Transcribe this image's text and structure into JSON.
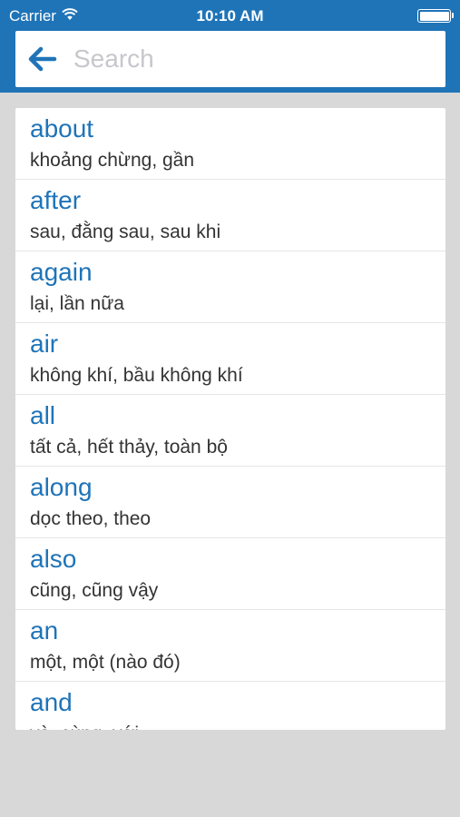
{
  "status": {
    "carrier": "Carrier",
    "time": "10:10 AM",
    "wifi_icon": "wifi-icon",
    "battery_icon": "battery-icon"
  },
  "search": {
    "placeholder": "Search",
    "back_icon": "arrow-left-icon"
  },
  "colors": {
    "accent": "#1f74b8",
    "background": "#d8d8d8",
    "card": "#ffffff",
    "divider": "#e6e6e6"
  },
  "words": [
    {
      "word": "about",
      "meaning": "khoảng chừng, gần"
    },
    {
      "word": "after",
      "meaning": "sau, đằng sau, sau khi"
    },
    {
      "word": "again",
      "meaning": "lại, lần nữa"
    },
    {
      "word": "air",
      "meaning": "không khí, bầu không khí"
    },
    {
      "word": "all",
      "meaning": "tất cả, hết thảy, toàn bộ"
    },
    {
      "word": "along",
      "meaning": "dọc theo, theo"
    },
    {
      "word": "also",
      "meaning": "cũng, cũng vậy"
    },
    {
      "word": "an",
      "meaning": "một, một (nào đó)"
    },
    {
      "word": "and",
      "meaning": "và, cùng, với"
    }
  ]
}
